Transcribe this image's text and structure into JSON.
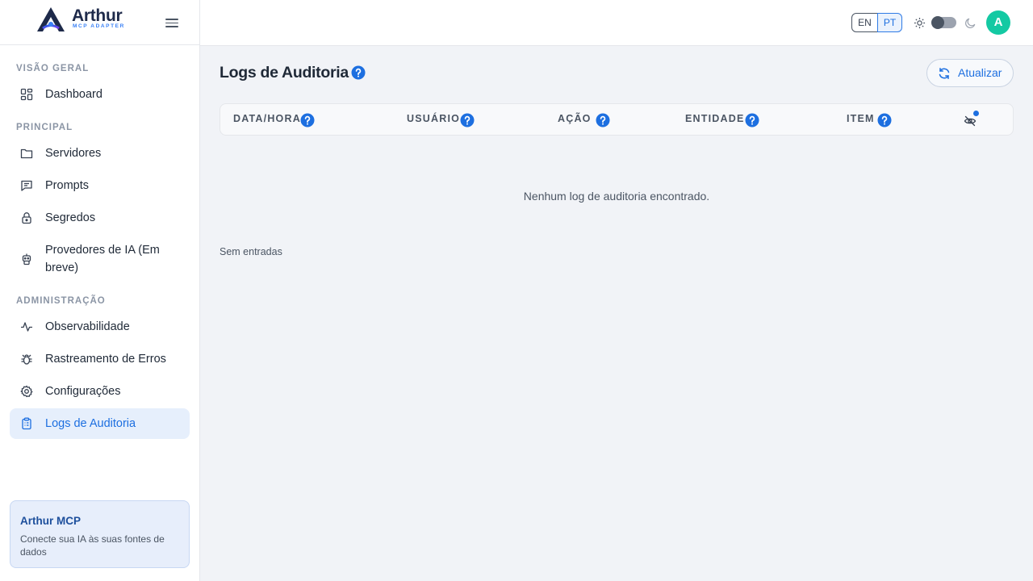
{
  "brand": {
    "name": "Arthur",
    "subtitle": "MCP ADAPTER",
    "logo_icon": "arthur-logo-icon",
    "menu_icon": "hamburger-menu-icon"
  },
  "sidebar": {
    "sections": [
      {
        "label": "VISÃO GERAL",
        "items": [
          {
            "label": "Dashboard",
            "icon": "dashboard-grid-icon"
          }
        ]
      },
      {
        "label": "PRINCIPAL",
        "items": [
          {
            "label": "Servidores",
            "icon": "folder-icon"
          },
          {
            "label": "Prompts",
            "icon": "message-square-icon"
          },
          {
            "label": "Segredos",
            "icon": "lock-icon"
          },
          {
            "label": "Provedores de IA (Em breve)",
            "icon": "robot-icon"
          }
        ]
      },
      {
        "label": "ADMINISTRAÇÃO",
        "items": [
          {
            "label": "Observabilidade",
            "icon": "activity-icon"
          },
          {
            "label": "Rastreamento de Erros",
            "icon": "bug-icon"
          },
          {
            "label": "Configurações",
            "icon": "gear-icon"
          },
          {
            "label": "Logs de Auditoria",
            "icon": "clipboard-icon",
            "active": true
          }
        ]
      }
    ],
    "promo": {
      "title": "Arthur MCP",
      "description": "Conecte sua IA às suas fontes de dados"
    }
  },
  "header": {
    "languages": [
      "EN",
      "PT"
    ],
    "active_language": "PT",
    "theme_light_icon": "sun-icon",
    "theme_dark_icon": "moon-icon",
    "avatar_initial": "A"
  },
  "main": {
    "title": "Logs de Auditoria",
    "refresh_label": "Atualizar",
    "table": {
      "columns": [
        "DATA/HORA",
        "USUÁRIO",
        "AÇÃO",
        "ENTIDADE",
        "ITEM"
      ],
      "column_visibility_icon": "eye-off-icon"
    },
    "empty_message": "Nenhum log de auditoria encontrado.",
    "entries_text": "Sem entradas"
  },
  "colors": {
    "accent": "#1d6fe0",
    "active_bg": "#e6effc",
    "avatar": "#14c9a3",
    "help_icon": "#1d6fe0"
  }
}
